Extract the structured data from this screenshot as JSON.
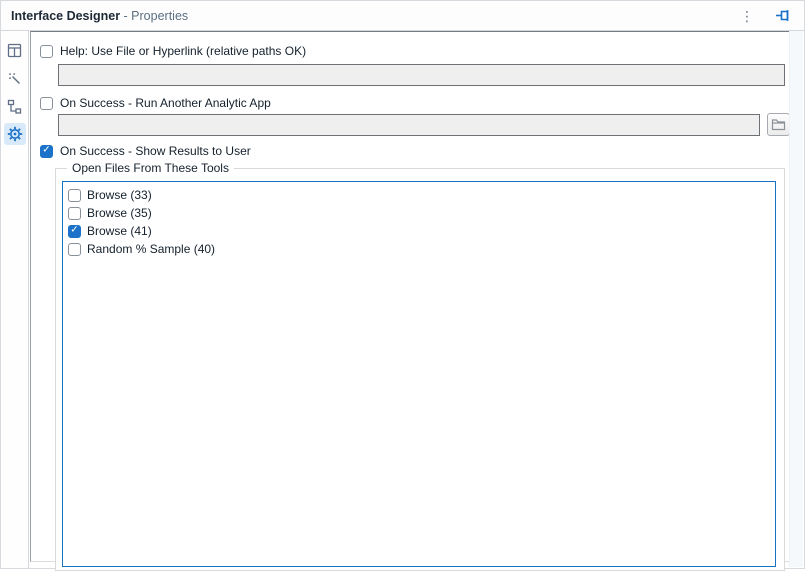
{
  "header": {
    "title_bold": "Interface Designer",
    "title_rest": " - Properties",
    "menu_glyph": "⋮"
  },
  "sidebar": {
    "items": [
      {
        "name": "layout-view",
        "active": false
      },
      {
        "name": "test-view",
        "active": false
      },
      {
        "name": "tree-view",
        "active": false
      },
      {
        "name": "properties-view",
        "active": true
      }
    ]
  },
  "form": {
    "help_checkbox": {
      "label": "Help: Use File or Hyperlink (relative paths OK)",
      "checked": false
    },
    "help_input": {
      "value": ""
    },
    "run_app_checkbox": {
      "label": "On Success - Run Another Analytic App",
      "checked": false
    },
    "run_app_input": {
      "value": ""
    },
    "browse_button": {
      "icon": "folder-browse-icon"
    },
    "show_results_checkbox": {
      "label": "On Success - Show Results to User",
      "checked": true
    },
    "group": {
      "legend": "Open Files From These Tools",
      "items": [
        {
          "label": "Browse (33)",
          "checked": false
        },
        {
          "label": "Browse (35)",
          "checked": false
        },
        {
          "label": "Browse (41)",
          "checked": true
        },
        {
          "label": "Random % Sample (40)",
          "checked": false
        }
      ]
    }
  },
  "colors": {
    "accent_blue": "#1b72c8",
    "listbox_border": "#1673c4",
    "input_bg": "#efefef",
    "icon_gray": "#5f6e85",
    "active_tab_bg": "#d8eafa"
  }
}
